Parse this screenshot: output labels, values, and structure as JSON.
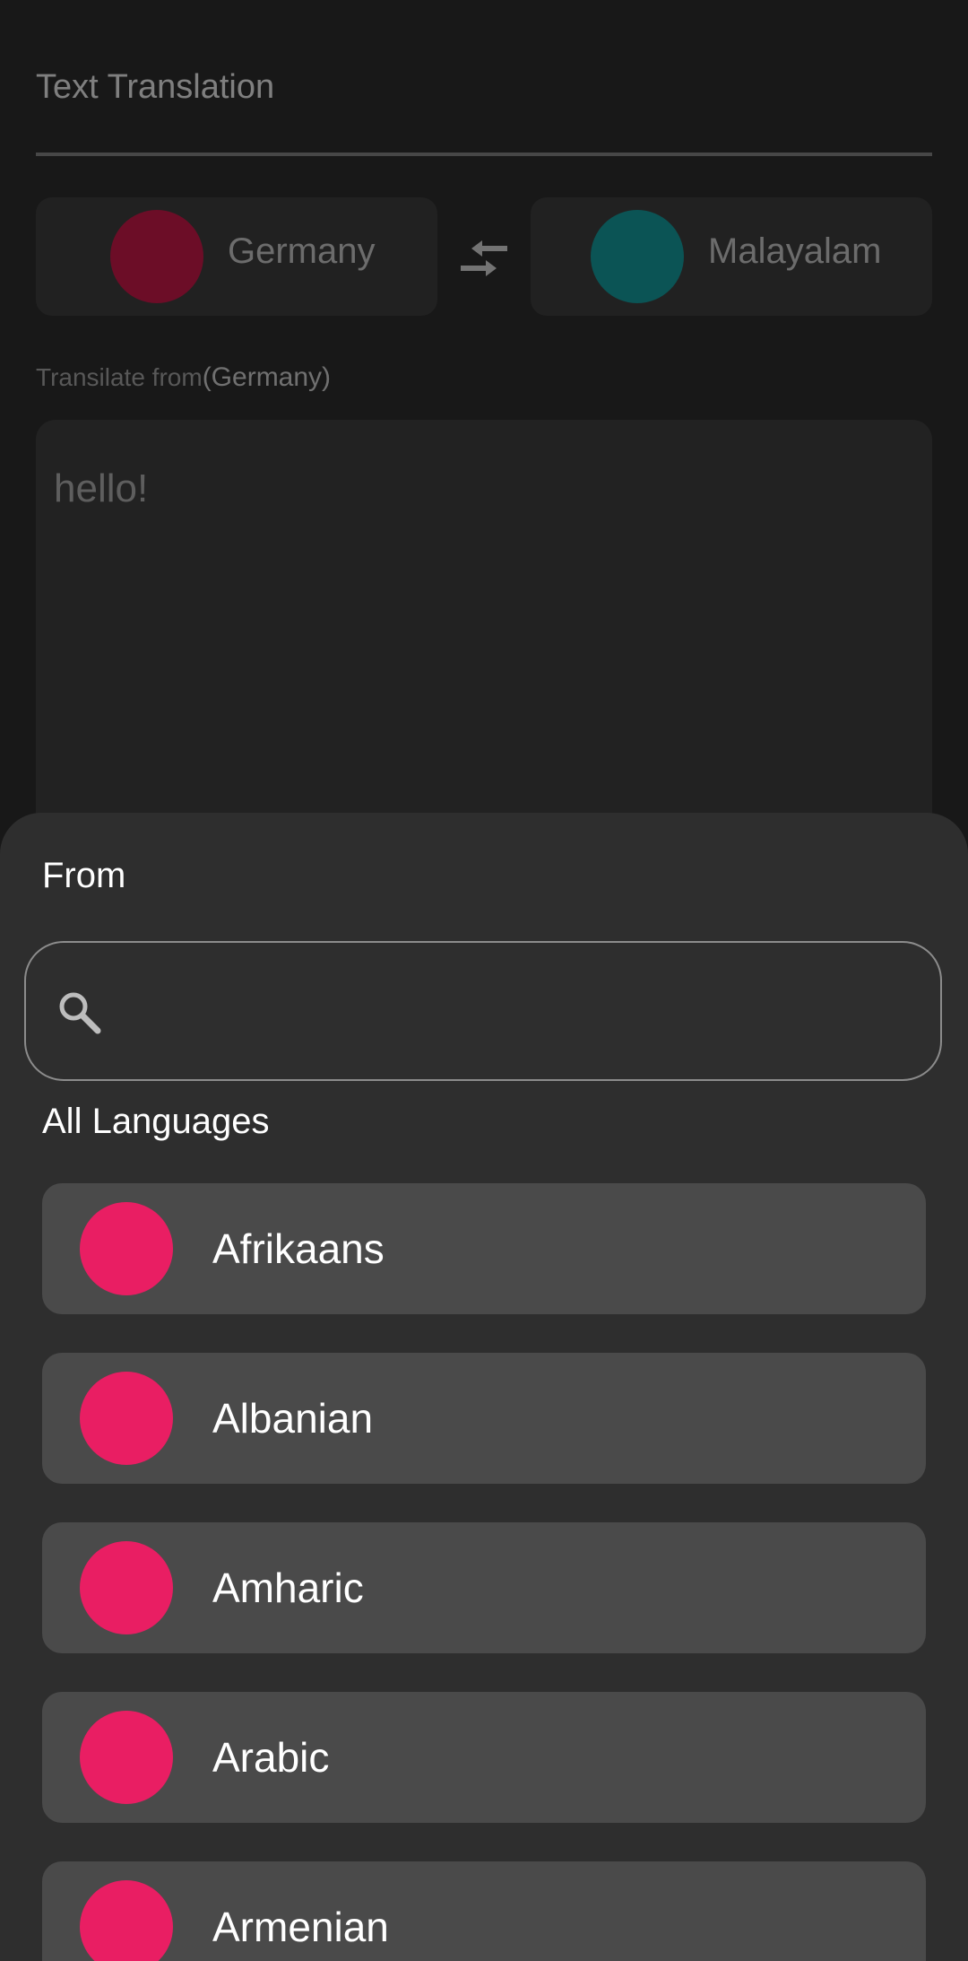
{
  "header": {
    "title": "Text Translation"
  },
  "languages": {
    "from": {
      "label": "Germany",
      "color": "#d81b4e"
    },
    "to": {
      "label": "Malayalam",
      "color": "#17a8aa"
    },
    "swap_icon": "swap-arrows-icon"
  },
  "translate": {
    "prefix": "Transilate from",
    "language": "(Germany)",
    "input_text": "hello!"
  },
  "sheet": {
    "title": "From",
    "search_icon": "search-icon",
    "section_label": "All Languages",
    "items": [
      {
        "label": "Afrikaans",
        "color": "#e91e63"
      },
      {
        "label": "Albanian",
        "color": "#e91e63"
      },
      {
        "label": "Amharic",
        "color": "#e91e63"
      },
      {
        "label": "Arabic",
        "color": "#e91e63"
      },
      {
        "label": "Armenian",
        "color": "#e91e63"
      }
    ]
  },
  "colors": {
    "accent": "#e91e63",
    "sheet_background": "#2e2e2e",
    "item_background": "#4a4a4a"
  }
}
